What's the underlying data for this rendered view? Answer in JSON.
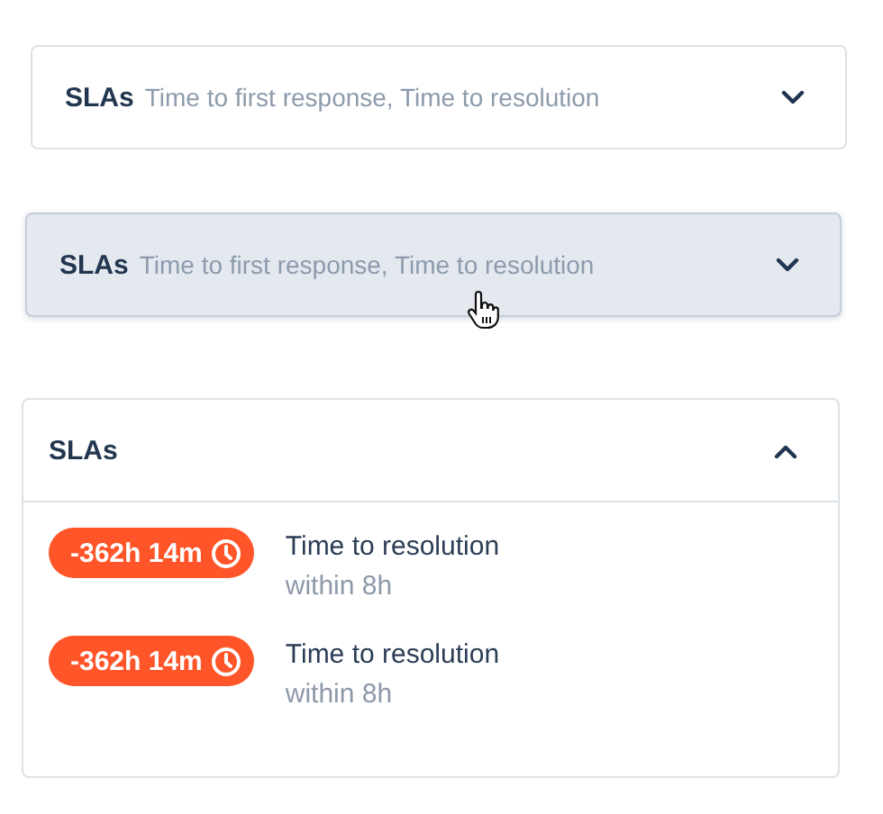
{
  "sections": [
    {
      "title": "SLAs",
      "summary": "Time to first response, Time to resolution",
      "expanded": false,
      "hovered": false
    },
    {
      "title": "SLAs",
      "summary": "Time to first response, Time to resolution",
      "expanded": false,
      "hovered": true
    },
    {
      "title": "SLAs",
      "expanded": true,
      "hovered": false,
      "items": [
        {
          "badge": "-362h 14m",
          "name": "Time to resolution",
          "target": "within 8h"
        },
        {
          "badge": "-362h 14m",
          "name": "Time to resolution",
          "target": "within 8h"
        }
      ]
    }
  ]
}
